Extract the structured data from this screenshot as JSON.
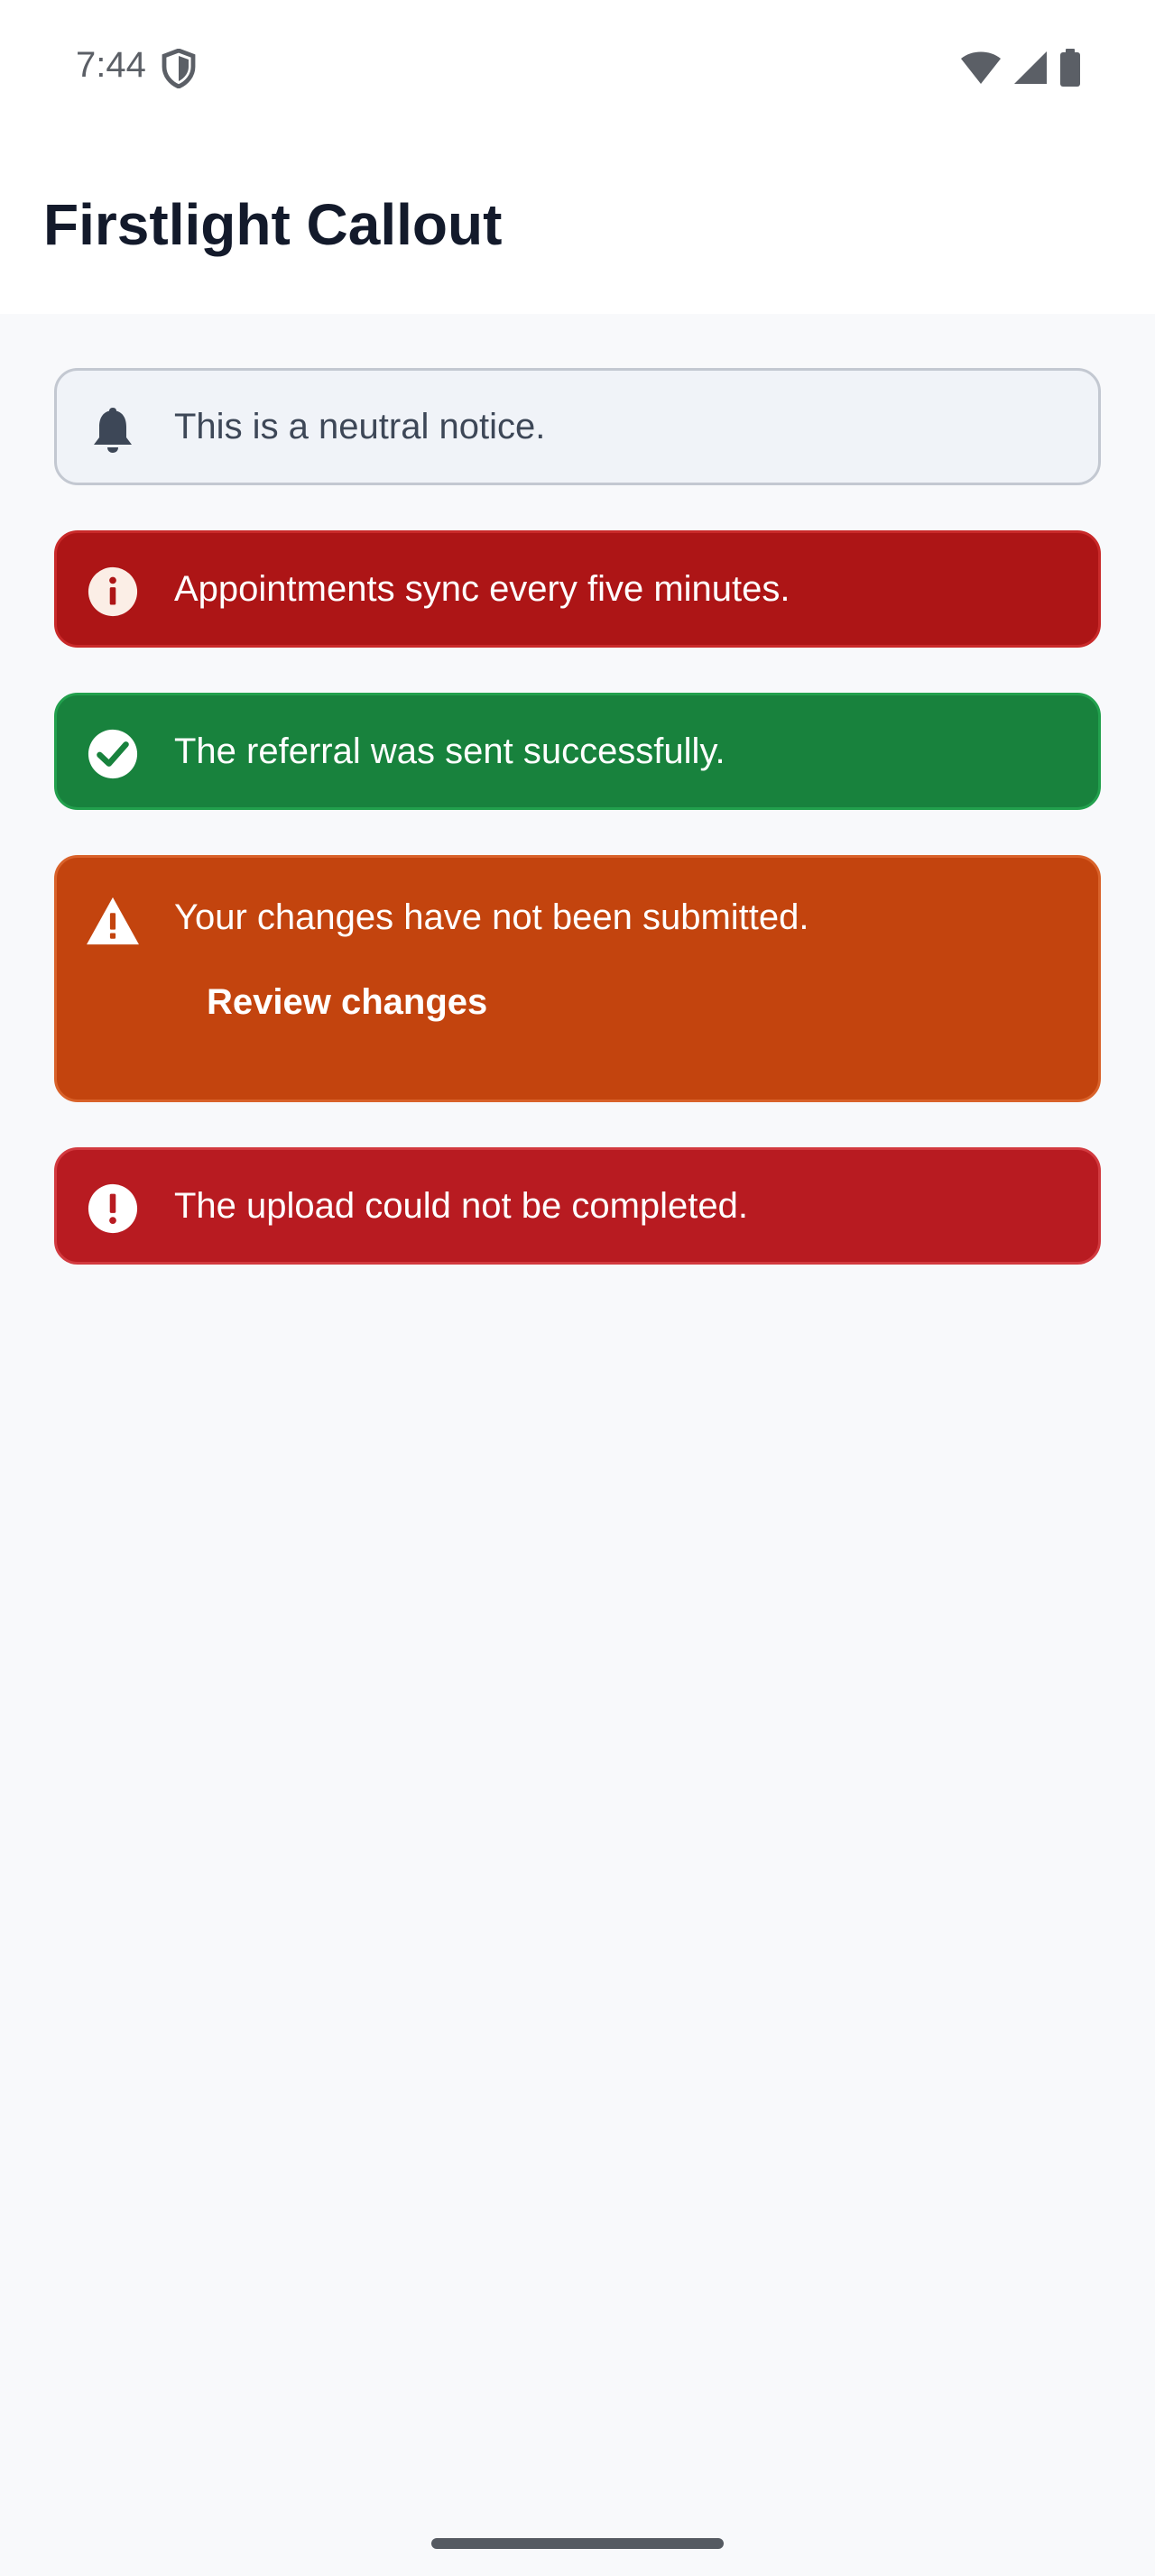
{
  "status_bar": {
    "time": "7:44",
    "icons": [
      "shield-icon",
      "wifi-icon",
      "signal-icon",
      "battery-icon"
    ]
  },
  "app_bar": {
    "title": "Firstlight Callout"
  },
  "callouts": [
    {
      "variant": "neutral",
      "icon": "bell-icon",
      "message": "This is a neutral notice.",
      "colors": {
        "background": "#f0f3f8",
        "border": "#c3c8d1",
        "text": "#3d4757"
      }
    },
    {
      "variant": "info",
      "icon": "info-circle-icon",
      "message": "Appointments sync every five minutes.",
      "colors": {
        "background": "#ad1516",
        "text": "#ffffff"
      }
    },
    {
      "variant": "success",
      "icon": "check-circle-icon",
      "message": "The referral was sent successfully.",
      "colors": {
        "background": "#18823d",
        "text": "#ffffff"
      }
    },
    {
      "variant": "warning",
      "icon": "warning-triangle-icon",
      "message": "Your changes have not been submitted.",
      "action_label": "Review changes",
      "colors": {
        "background": "#c3440e",
        "text": "#ffffff"
      }
    },
    {
      "variant": "error",
      "icon": "error-circle-icon",
      "message": "The upload could not be completed.",
      "colors": {
        "background": "#b81b21",
        "text": "#ffffff"
      }
    }
  ]
}
